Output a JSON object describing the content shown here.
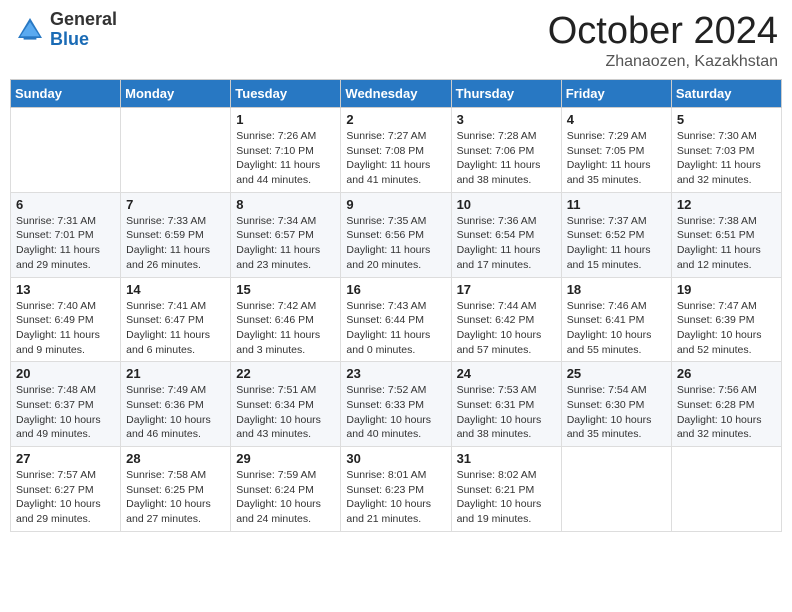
{
  "header": {
    "logo_general": "General",
    "logo_blue": "Blue",
    "month_title": "October 2024",
    "location": "Zhanaozen, Kazakhstan"
  },
  "weekdays": [
    "Sunday",
    "Monday",
    "Tuesday",
    "Wednesday",
    "Thursday",
    "Friday",
    "Saturday"
  ],
  "weeks": [
    [
      {
        "day": "",
        "info": ""
      },
      {
        "day": "",
        "info": ""
      },
      {
        "day": "1",
        "info": "Sunrise: 7:26 AM\nSunset: 7:10 PM\nDaylight: 11 hours and 44 minutes."
      },
      {
        "day": "2",
        "info": "Sunrise: 7:27 AM\nSunset: 7:08 PM\nDaylight: 11 hours and 41 minutes."
      },
      {
        "day": "3",
        "info": "Sunrise: 7:28 AM\nSunset: 7:06 PM\nDaylight: 11 hours and 38 minutes."
      },
      {
        "day": "4",
        "info": "Sunrise: 7:29 AM\nSunset: 7:05 PM\nDaylight: 11 hours and 35 minutes."
      },
      {
        "day": "5",
        "info": "Sunrise: 7:30 AM\nSunset: 7:03 PM\nDaylight: 11 hours and 32 minutes."
      }
    ],
    [
      {
        "day": "6",
        "info": "Sunrise: 7:31 AM\nSunset: 7:01 PM\nDaylight: 11 hours and 29 minutes."
      },
      {
        "day": "7",
        "info": "Sunrise: 7:33 AM\nSunset: 6:59 PM\nDaylight: 11 hours and 26 minutes."
      },
      {
        "day": "8",
        "info": "Sunrise: 7:34 AM\nSunset: 6:57 PM\nDaylight: 11 hours and 23 minutes."
      },
      {
        "day": "9",
        "info": "Sunrise: 7:35 AM\nSunset: 6:56 PM\nDaylight: 11 hours and 20 minutes."
      },
      {
        "day": "10",
        "info": "Sunrise: 7:36 AM\nSunset: 6:54 PM\nDaylight: 11 hours and 17 minutes."
      },
      {
        "day": "11",
        "info": "Sunrise: 7:37 AM\nSunset: 6:52 PM\nDaylight: 11 hours and 15 minutes."
      },
      {
        "day": "12",
        "info": "Sunrise: 7:38 AM\nSunset: 6:51 PM\nDaylight: 11 hours and 12 minutes."
      }
    ],
    [
      {
        "day": "13",
        "info": "Sunrise: 7:40 AM\nSunset: 6:49 PM\nDaylight: 11 hours and 9 minutes."
      },
      {
        "day": "14",
        "info": "Sunrise: 7:41 AM\nSunset: 6:47 PM\nDaylight: 11 hours and 6 minutes."
      },
      {
        "day": "15",
        "info": "Sunrise: 7:42 AM\nSunset: 6:46 PM\nDaylight: 11 hours and 3 minutes."
      },
      {
        "day": "16",
        "info": "Sunrise: 7:43 AM\nSunset: 6:44 PM\nDaylight: 11 hours and 0 minutes."
      },
      {
        "day": "17",
        "info": "Sunrise: 7:44 AM\nSunset: 6:42 PM\nDaylight: 10 hours and 57 minutes."
      },
      {
        "day": "18",
        "info": "Sunrise: 7:46 AM\nSunset: 6:41 PM\nDaylight: 10 hours and 55 minutes."
      },
      {
        "day": "19",
        "info": "Sunrise: 7:47 AM\nSunset: 6:39 PM\nDaylight: 10 hours and 52 minutes."
      }
    ],
    [
      {
        "day": "20",
        "info": "Sunrise: 7:48 AM\nSunset: 6:37 PM\nDaylight: 10 hours and 49 minutes."
      },
      {
        "day": "21",
        "info": "Sunrise: 7:49 AM\nSunset: 6:36 PM\nDaylight: 10 hours and 46 minutes."
      },
      {
        "day": "22",
        "info": "Sunrise: 7:51 AM\nSunset: 6:34 PM\nDaylight: 10 hours and 43 minutes."
      },
      {
        "day": "23",
        "info": "Sunrise: 7:52 AM\nSunset: 6:33 PM\nDaylight: 10 hours and 40 minutes."
      },
      {
        "day": "24",
        "info": "Sunrise: 7:53 AM\nSunset: 6:31 PM\nDaylight: 10 hours and 38 minutes."
      },
      {
        "day": "25",
        "info": "Sunrise: 7:54 AM\nSunset: 6:30 PM\nDaylight: 10 hours and 35 minutes."
      },
      {
        "day": "26",
        "info": "Sunrise: 7:56 AM\nSunset: 6:28 PM\nDaylight: 10 hours and 32 minutes."
      }
    ],
    [
      {
        "day": "27",
        "info": "Sunrise: 7:57 AM\nSunset: 6:27 PM\nDaylight: 10 hours and 29 minutes."
      },
      {
        "day": "28",
        "info": "Sunrise: 7:58 AM\nSunset: 6:25 PM\nDaylight: 10 hours and 27 minutes."
      },
      {
        "day": "29",
        "info": "Sunrise: 7:59 AM\nSunset: 6:24 PM\nDaylight: 10 hours and 24 minutes."
      },
      {
        "day": "30",
        "info": "Sunrise: 8:01 AM\nSunset: 6:23 PM\nDaylight: 10 hours and 21 minutes."
      },
      {
        "day": "31",
        "info": "Sunrise: 8:02 AM\nSunset: 6:21 PM\nDaylight: 10 hours and 19 minutes."
      },
      {
        "day": "",
        "info": ""
      },
      {
        "day": "",
        "info": ""
      }
    ]
  ]
}
